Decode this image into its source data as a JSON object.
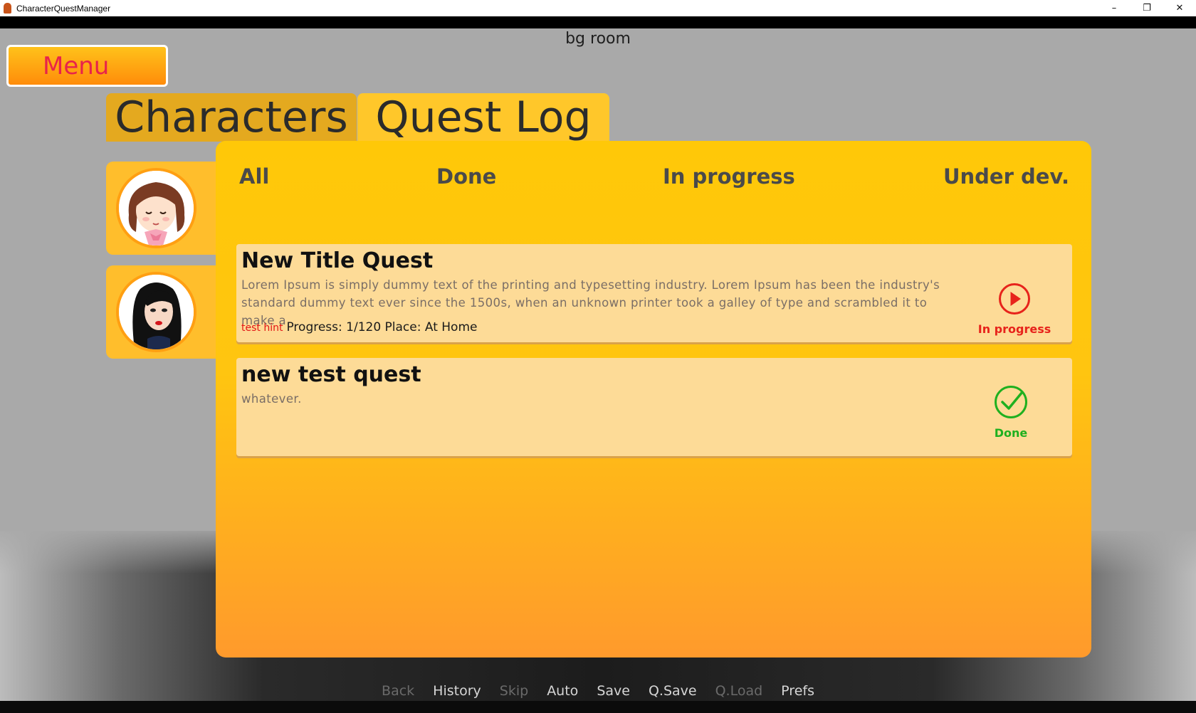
{
  "window": {
    "title": "CharacterQuestManager"
  },
  "scene": {
    "background_label": "bg room"
  },
  "menu": {
    "label": "Menu"
  },
  "tabs": [
    {
      "label": "Characters",
      "active": false
    },
    {
      "label": "Quest Log",
      "active": true
    }
  ],
  "characters": [
    {
      "name": "girl-with-brown-hair"
    },
    {
      "name": "girl-with-black-hair"
    }
  ],
  "filters": [
    "All",
    "Done",
    "In progress",
    "Under dev."
  ],
  "quests": [
    {
      "title": "New Title Quest",
      "description": "Lorem Ipsum is simply dummy text of the printing and typesetting industry. Lorem Ipsum has been the industry's standard dummy text ever since the 1500s, when an unknown printer took a galley of type and scrambled it to make a",
      "hint": "test hint",
      "meta": "Progress:  1/120  Place:  At Home",
      "status": "In progress",
      "status_icon": "play-circle-icon"
    },
    {
      "title": "new test quest",
      "description": "whatever.",
      "status": "Done",
      "status_icon": "check-circle-icon"
    }
  ],
  "quick_menu": [
    {
      "label": "Back",
      "enabled": false
    },
    {
      "label": "History",
      "enabled": true
    },
    {
      "label": "Skip",
      "enabled": false
    },
    {
      "label": "Auto",
      "enabled": true
    },
    {
      "label": "Save",
      "enabled": true
    },
    {
      "label": "Q.Save",
      "enabled": true
    },
    {
      "label": "Q.Load",
      "enabled": false
    },
    {
      "label": "Prefs",
      "enabled": true
    }
  ],
  "colors": {
    "accent": "#ffc808",
    "menu_text": "#e8234b",
    "in_progress": "#e7231b",
    "done": "#1fb01f"
  }
}
